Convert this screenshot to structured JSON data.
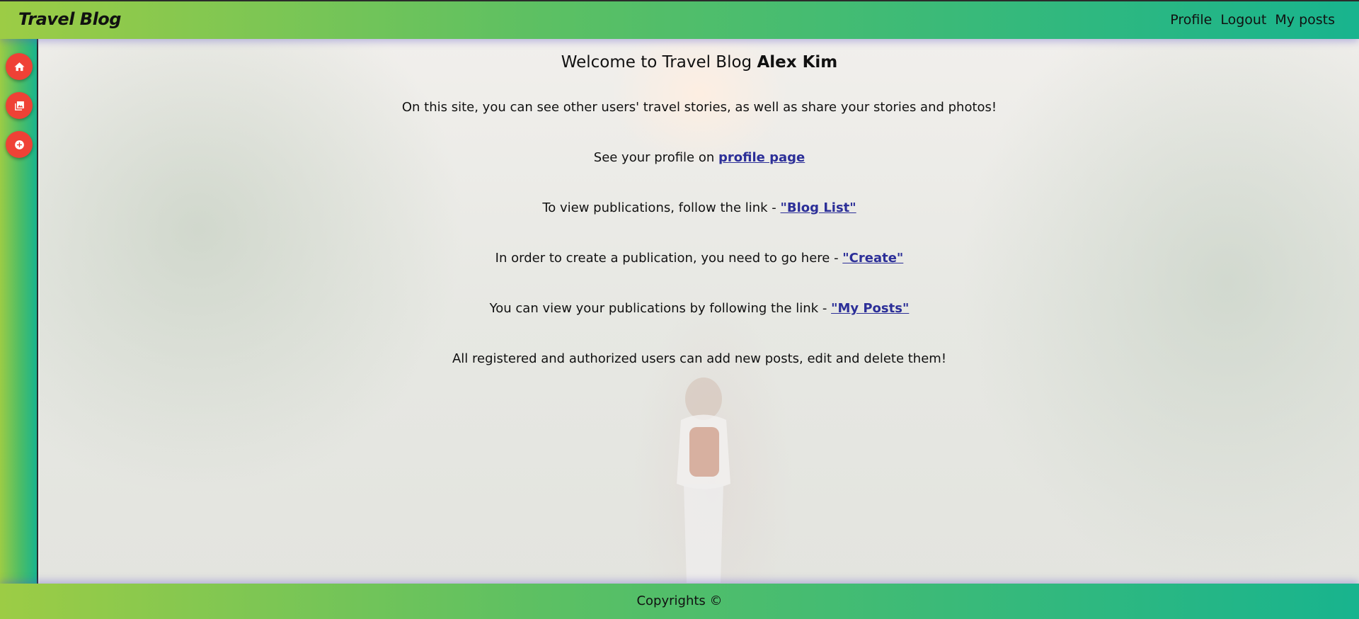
{
  "header": {
    "brand": "Travel Blog",
    "nav": [
      "Profile",
      "Logout",
      "My posts"
    ]
  },
  "sidebar": {
    "buttons": [
      {
        "icon": "home-icon"
      },
      {
        "icon": "gallery-icon"
      },
      {
        "icon": "add-circle-icon"
      }
    ]
  },
  "main": {
    "title_prefix": "Welcome to Travel Blog ",
    "user_name": "Alex Kim",
    "intro": "On this site, you can see other users' travel stories, as well as share your stories and photos!",
    "profile_text": "See your profile on ",
    "profile_link": "profile page",
    "bloglist_text": "To view publications, follow the link - ",
    "bloglist_link": "\"Blog List\"",
    "create_text": "In order to create a publication, you need to go here - ",
    "create_link": "\"Create\"",
    "myposts_text": "You can view your publications by following the link - ",
    "myposts_link": "\"My Posts\"",
    "note": "All registered and authorized users can add new posts, edit and delete them!"
  },
  "footer": {
    "copyright": "Copyrights ©"
  },
  "colors": {
    "accent_fab": "#ef4136",
    "link": "#2c2f98",
    "gradient_start": "#9ccc45",
    "gradient_end": "#18b48e"
  }
}
